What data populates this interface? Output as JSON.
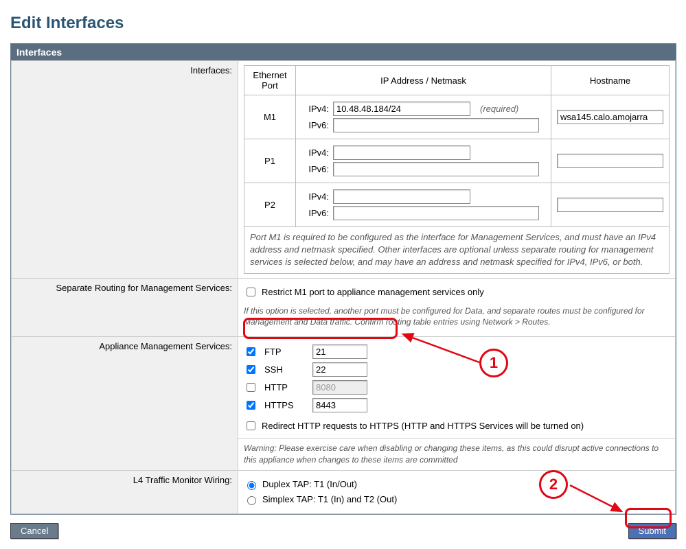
{
  "page_title": "Edit Interfaces",
  "panel_header": "Interfaces",
  "labels": {
    "interfaces": "Interfaces:",
    "separate_routing": "Separate Routing for Management Services:",
    "appliance_services": "Appliance Management Services:",
    "l4_wiring": "L4 Traffic Monitor Wiring:"
  },
  "inner_headers": {
    "port": "Ethernet Port",
    "ip": "IP Address / Netmask",
    "host": "Hostname"
  },
  "ip_labels": {
    "v4": "IPv4:",
    "v6": "IPv6:"
  },
  "required_text": "(required)",
  "ports": [
    {
      "name": "M1",
      "ipv4": "10.48.48.184/24",
      "ipv6": "",
      "hostname": "wsa145.calo.amojarra",
      "required": true
    },
    {
      "name": "P1",
      "ipv4": "",
      "ipv6": "",
      "hostname": "",
      "required": false
    },
    {
      "name": "P2",
      "ipv4": "",
      "ipv6": "",
      "hostname": "",
      "required": false
    }
  ],
  "port_note": "Port M1 is required to be configured as the interface for Management Services, and must have an IPv4 address and netmask specified. Other interfaces are optional unless separate routing for management services is selected below, and may have an address and netmask specified for IPv4, IPv6, or both.",
  "restrict": {
    "checked": false,
    "label": "Restrict M1 port to appliance management services only",
    "note": "If this option is selected, another port must be configured for Data, and separate routes must be configured for Management and Data traffic. Confirm routing table entries using Network > Routes."
  },
  "services": {
    "ftp": {
      "checked": true,
      "label": "FTP",
      "port": "21",
      "disabled": false
    },
    "ssh": {
      "checked": true,
      "label": "SSH",
      "port": "22",
      "disabled": false
    },
    "http": {
      "checked": false,
      "label": "HTTP",
      "port": "8080",
      "disabled": true
    },
    "https": {
      "checked": true,
      "label": "HTTPS",
      "port": "8443",
      "disabled": false
    }
  },
  "redirect": {
    "checked": false,
    "label": "Redirect HTTP requests to HTTPS (HTTP and HTTPS Services will be turned on)"
  },
  "services_note": "Warning: Please exercise care when disabling or changing these items, as this could disrupt active connections to this appliance when changes to these items are committed",
  "l4": {
    "duplex": "Duplex TAP: T1 (In/Out)",
    "simplex": "Simplex TAP: T1 (In) and T2 (Out)",
    "selected": "duplex"
  },
  "buttons": {
    "cancel": "Cancel",
    "submit": "Submit"
  },
  "annotations": {
    "one": "1",
    "two": "2"
  }
}
